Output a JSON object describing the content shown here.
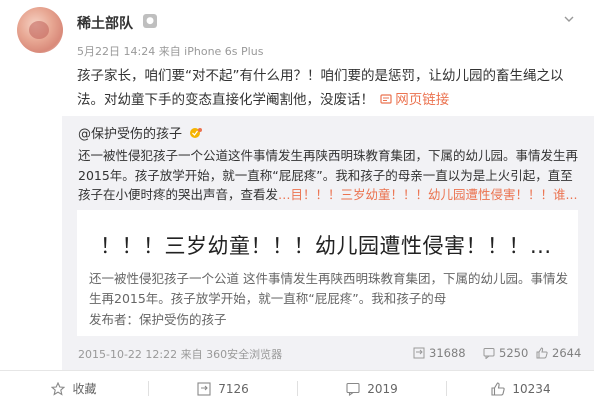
{
  "post": {
    "author": "稀土部队",
    "meta": "5月22日 14:24 来自 iPhone 6s Plus",
    "text_main": "孩子家长，咱们要“对不起”有什么用？！咱们要的是惩罚，让幼儿园的畜生绳之以法。对幼童下手的变态直接化学阉割他，没废话！",
    "link_label": "网页链接"
  },
  "repost": {
    "author": "@保护受伤的孩子",
    "text_main": "还一被性侵犯孩子一个公道这件事情发生再陕西明珠教育集团，下属的幼儿园。事情发生再2015年。孩子放学开始，就一直称“屁屁疼”。我和孩子的母亲一直以为是上火引起，直至孩子在小便时疼的哭出声音，查看发",
    "text_hl": "…目！！！三岁幼童！！！幼儿园遭性侵害！！！谁...",
    "card": {
      "title": "！！！三岁幼童！！！幼儿园遭性侵害！！！...",
      "body": "还一被性侵犯孩子一个公道 这件事情发生再陕西明珠教育集团，下属的幼儿园。事情发生再2015年。孩子放学开始，就一直称“屁屁疼”。我和孩子的母",
      "source": "发布者：保护受伤的孩子"
    },
    "time": "2015-10-22 12:22 来自 360安全浏览器",
    "reposts": "31688",
    "comments": "5250",
    "likes": "2644"
  },
  "actions": {
    "favorite": "收藏",
    "repost": "7126",
    "comment": "2019",
    "like": "10234"
  },
  "colors": {
    "link": "#eb7350",
    "repost_bg": "#f2f2f5",
    "meta": "#999999"
  }
}
